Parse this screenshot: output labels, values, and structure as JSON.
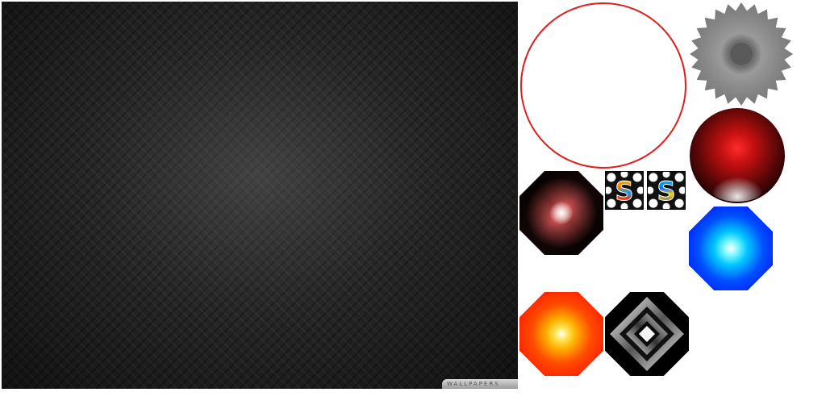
{
  "texture_panel": {
    "watermark_text": "WALLPAPERS"
  },
  "sprites": {
    "ring_color": "#e02020",
    "gear_color": "#8a8a8a",
    "orb_color": "#e01c1c",
    "gem_blue_color": "#0050ff",
    "gem_orange_color": "#ff4c00",
    "tile_warm_letter": "S",
    "tile_cool_letter": "S"
  }
}
